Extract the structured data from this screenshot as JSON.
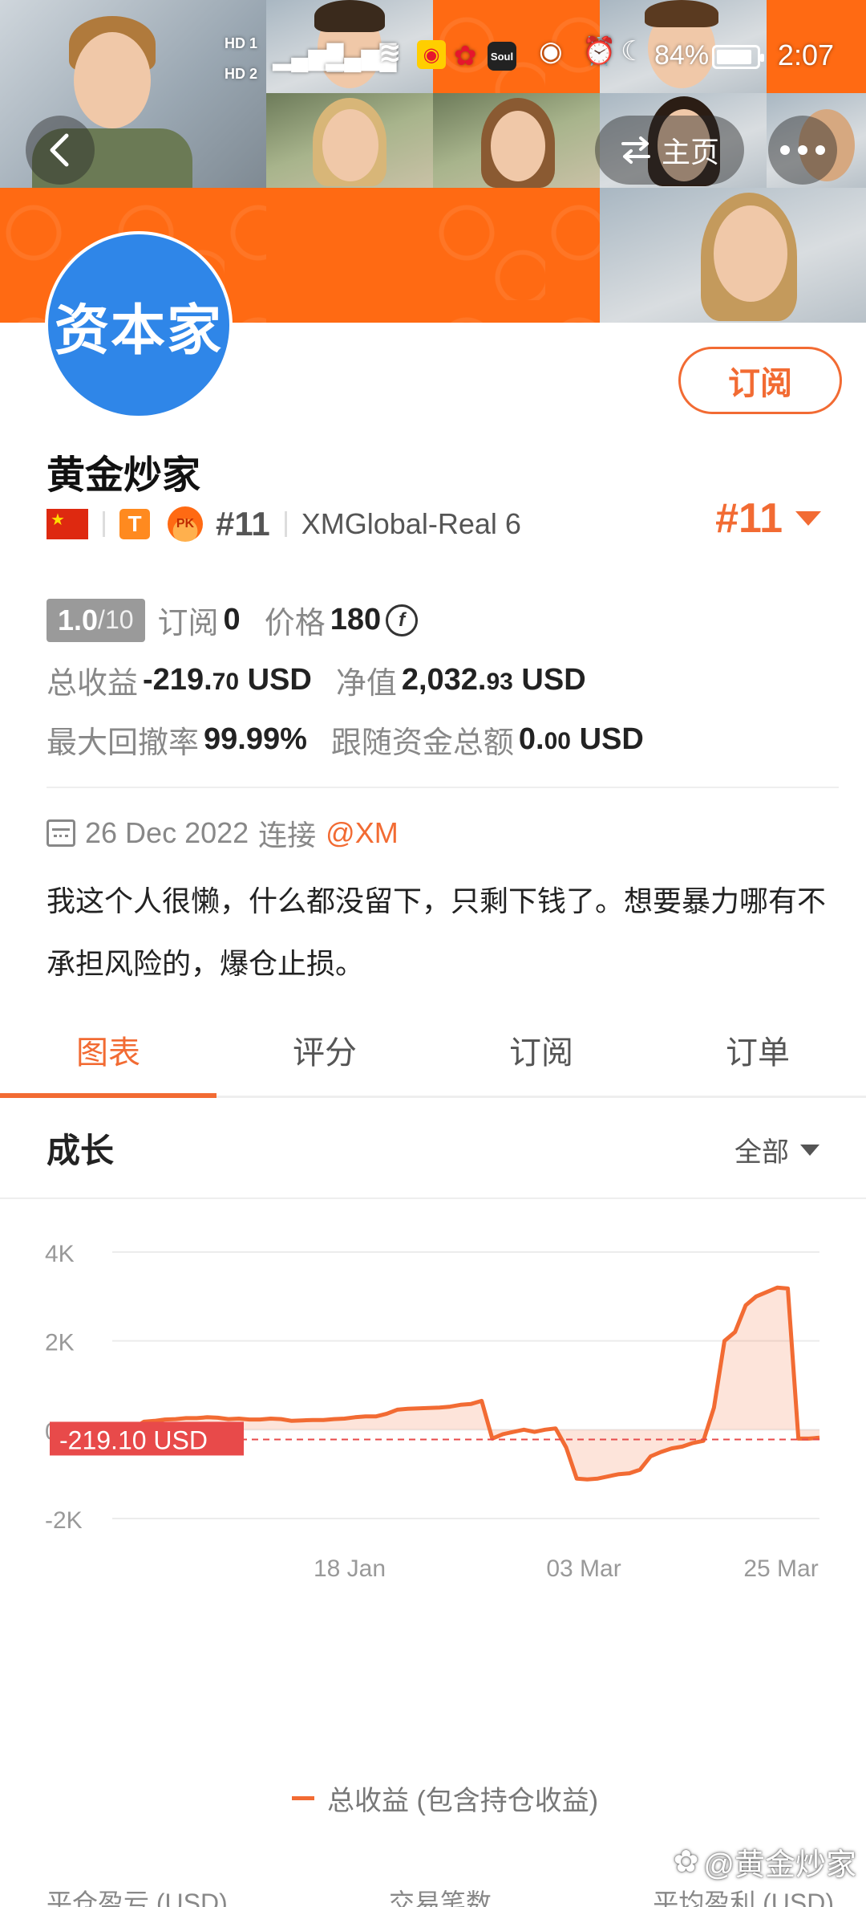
{
  "status_bar": {
    "hd1": "HD 1",
    "hd2": "HD 2",
    "battery_percent": "84%",
    "time": "2:07"
  },
  "header": {
    "home_label": "主页",
    "avatar_text": "资本家"
  },
  "profile": {
    "subscribe_label": "订阅",
    "name": "黄金炒家",
    "tier_badge": "T",
    "pk_badge": "PK",
    "rank_small": "#11",
    "server": "XMGlobal-Real 6",
    "rank_big": "#11"
  },
  "stats": {
    "score": "1.0",
    "score_denominator": "/10",
    "subscribers_label": "订阅",
    "subscribers_value": "0",
    "price_label": "价格",
    "price_value": "180",
    "coin_symbol": "f",
    "total_profit_label": "总收益",
    "total_profit_int": "-219.",
    "total_profit_dec": "70",
    "total_profit_unit": "USD",
    "equity_label": "净值",
    "equity_int": "2,032.",
    "equity_dec": "93",
    "equity_unit": "USD",
    "max_drawdown_label": "最大回撤率",
    "max_drawdown_value": "99.99%",
    "follow_total_label": "跟随资金总额",
    "follow_total_int": "0.",
    "follow_total_dec": "00",
    "follow_total_unit": "USD"
  },
  "connect": {
    "date": "26 Dec 2022",
    "connect_label": "连接",
    "broker": "@XM"
  },
  "bio": "我这个人很懒，什么都没留下，只剩下钱了。想要暴力哪有不承担风险的，爆仓止损。",
  "tabs": [
    {
      "label": "图表",
      "active": true
    },
    {
      "label": "评分",
      "active": false
    },
    {
      "label": "订阅",
      "active": false
    },
    {
      "label": "订单",
      "active": false
    }
  ],
  "growth": {
    "title": "成长",
    "range_label": "全部"
  },
  "chart_data": {
    "type": "area",
    "series": [
      {
        "name": "总收益 (包含持仓收益)",
        "color": "#f26b33",
        "values": [
          0,
          0,
          30,
          180,
          200,
          230,
          240,
          260,
          260,
          280,
          270,
          240,
          250,
          230,
          230,
          250,
          240,
          200,
          210,
          220,
          220,
          240,
          250,
          280,
          300,
          300,
          360,
          450,
          470,
          480,
          490,
          500,
          520,
          560,
          580,
          650,
          -200,
          -100,
          -50,
          0,
          -50,
          0,
          30,
          -400,
          -1100,
          -1120,
          -1100,
          -1050,
          -1000,
          -980,
          -900,
          -600,
          -500,
          -420,
          -380,
          -300,
          -250,
          500,
          2000,
          2200,
          2800,
          3000,
          3100,
          3200,
          3180,
          -200,
          -200,
          -180
        ]
      }
    ],
    "x_ticks": [
      "18 Jan",
      "03 Mar",
      "25 Mar"
    ],
    "y_ticks": [
      "4K",
      "2K",
      "0",
      "-2K"
    ],
    "ylim": [
      -2000,
      4000
    ],
    "reference_line": {
      "value": -219.1,
      "label": "-219.10 USD",
      "color": "#e84a4a"
    },
    "grid": true,
    "legend": "bottom-center"
  },
  "legend_label": "总收益 (包含持仓收益)",
  "bottom_labels": {
    "col1": "平仓盈亏 (USD)",
    "col2": "交易笔数",
    "col3": "平均盈利 (USD)"
  },
  "watermark": "@黄金炒家"
}
